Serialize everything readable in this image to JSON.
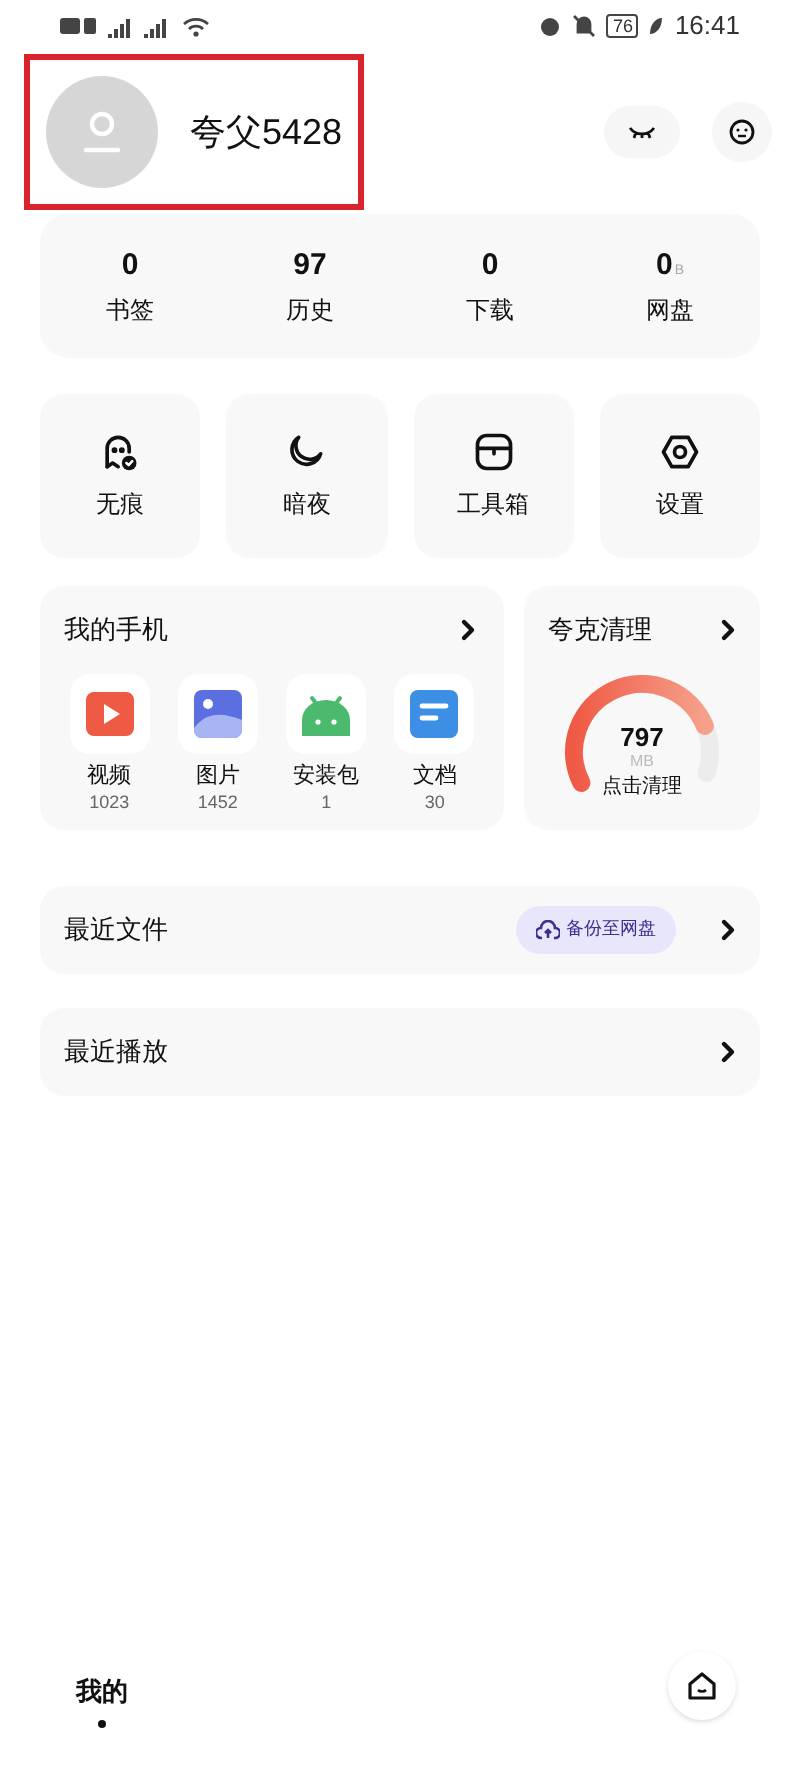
{
  "status_bar": {
    "battery": "76",
    "time": "16:41"
  },
  "profile": {
    "name": "夸父5428",
    "highlighted": true
  },
  "stats": [
    {
      "value": "0",
      "label": "书签"
    },
    {
      "value": "97",
      "label": "历史"
    },
    {
      "value": "0",
      "label": "下载"
    },
    {
      "value": "0",
      "unit": "B",
      "label": "网盘"
    }
  ],
  "tools": [
    {
      "kind": "ghost",
      "label": "无痕"
    },
    {
      "kind": "moon",
      "label": "暗夜"
    },
    {
      "kind": "toolbox",
      "label": "工具箱"
    },
    {
      "kind": "settings",
      "label": "设置"
    }
  ],
  "my_phone": {
    "title": "我的手机",
    "items": [
      {
        "kind": "video",
        "label": "视频",
        "count": "1023"
      },
      {
        "kind": "image",
        "label": "图片",
        "count": "1452"
      },
      {
        "kind": "apk",
        "label": "安装包",
        "count": "1"
      },
      {
        "kind": "doc",
        "label": "文档",
        "count": "30"
      }
    ]
  },
  "cleaner": {
    "title": "夸克清理",
    "value": "797",
    "unit": "MB",
    "action": "点击清理"
  },
  "recent_files": {
    "title": "最近文件",
    "badge": "备份至网盘"
  },
  "recent_play": {
    "title": "最近播放"
  },
  "bottom_nav": {
    "tabs": [
      {
        "label": "我的",
        "selected": true
      }
    ]
  }
}
